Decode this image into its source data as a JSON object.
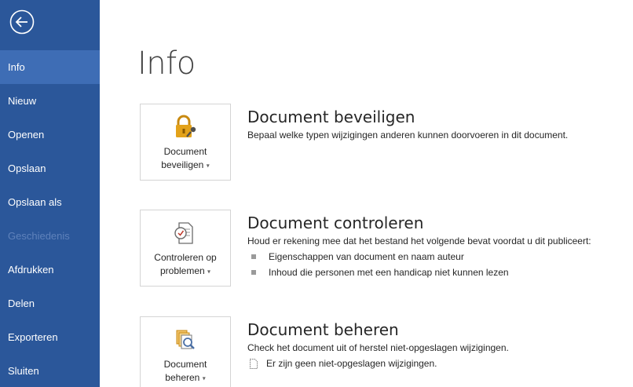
{
  "sidebar": {
    "items": [
      {
        "label": "Info",
        "state": "active"
      },
      {
        "label": "Nieuw",
        "state": "normal"
      },
      {
        "label": "Openen",
        "state": "normal"
      },
      {
        "label": "Opslaan",
        "state": "normal"
      },
      {
        "label": "Opslaan als",
        "state": "normal"
      },
      {
        "label": "Geschiedenis",
        "state": "disabled"
      },
      {
        "label": "Afdrukken",
        "state": "normal"
      },
      {
        "label": "Delen",
        "state": "normal"
      },
      {
        "label": "Exporteren",
        "state": "normal"
      },
      {
        "label": "Sluiten",
        "state": "normal"
      }
    ]
  },
  "main": {
    "title": "Info",
    "sections": [
      {
        "tile_line1": "Document",
        "tile_line2": "beveiligen",
        "icon": "lock-key-icon",
        "title": "Document beveiligen",
        "description": "Bepaal welke typen wijzigingen anderen kunnen doorvoeren in dit document."
      },
      {
        "tile_line1": "Controleren op",
        "tile_line2": "problemen",
        "icon": "inspect-document-icon",
        "title": "Document controleren",
        "description": "Houd er rekening mee dat het bestand het volgende bevat voordat u dit publiceert:",
        "bullets": [
          "Eigenschappen van document en naam auteur",
          "Inhoud die personen met een handicap niet kunnen lezen"
        ]
      },
      {
        "tile_line1": "Document",
        "tile_line2": "beheren",
        "icon": "manage-document-icon",
        "title": "Document beheren",
        "description": "Check het document uit of herstel niet-opgeslagen wijzigingen.",
        "note": "Er zijn geen niet-opgeslagen wijzigingen."
      }
    ]
  },
  "colors": {
    "sidebar_bg": "#2b579a",
    "sidebar_active": "#3e6db5",
    "lock_gold": "#e3a21a"
  }
}
